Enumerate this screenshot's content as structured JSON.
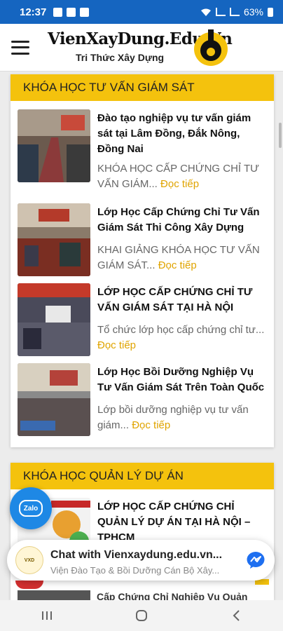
{
  "status_bar": {
    "time": "12:37",
    "battery": "63%"
  },
  "header": {
    "logo_title": "VienXayDung.Edu.Vn",
    "logo_subtitle": "Tri Thức Xây Dựng",
    "menu_icon": "hamburger-icon"
  },
  "sections": [
    {
      "title": "KHÓA HỌC TƯ VẤN GIÁM SÁT",
      "posts": [
        {
          "title": "Đào tạo nghiệp vụ tư vấn giám sát tại Lâm Đồng, Đắk Nông, Đồng Nai",
          "excerpt": "KHÓA HỌC CẤP CHỨNG CHỈ TƯ VẤN GIÁM...",
          "read_more": "Đọc tiếp"
        },
        {
          "title": "Lớp Học Cấp Chứng Chỉ Tư Vấn Giám Sát Thi Công Xây Dựng",
          "excerpt": "KHAI GIẢNG KHÓA HỌC TƯ VẤN GIÁM SÁT...",
          "read_more": "Đọc tiếp"
        },
        {
          "title": "LỚP HỌC CẤP CHỨNG CHỈ TƯ VẤN GIÁM SÁT TẠI HÀ NỘI",
          "excerpt": "Tổ chức lớp học cấp chứng chỉ tư...",
          "read_more": "Đọc tiếp"
        },
        {
          "title": "Lớp Học Bồi Dưỡng Nghiệp Vụ Tư Vấn Giám Sát Trên Toàn Quốc",
          "excerpt": "Lớp bồi dưỡng nghiệp vụ tư vấn giám...",
          "read_more": "Đọc tiếp"
        }
      ]
    },
    {
      "title": "KHÓA HỌC QUẢN LÝ DỰ ÁN",
      "posts": [
        {
          "title": "LỚP HỌC CẤP CHỨNG CHỈ QUẢN LÝ DỰ ÁN TẠI HÀ NỘI – TPHCM",
          "excerpt": "",
          "read_more": ""
        }
      ]
    }
  ],
  "zalo": {
    "label": "Zalo"
  },
  "chat": {
    "title": "Chat with Vienxaydung.edu.vn...",
    "subtitle": "Viện Đào Tạo & Bồi Dưỡng Cán Bộ Xây..."
  },
  "partial_post_title": "Cấp Chứng Chỉ Nghiệp Vụ Quản",
  "colors": {
    "accent": "#f4c20d",
    "status_bar": "#1565c0",
    "link": "#e0a400"
  }
}
